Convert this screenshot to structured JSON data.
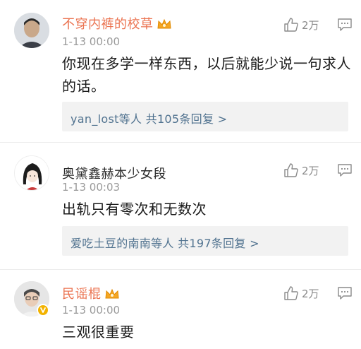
{
  "comments": [
    {
      "username": "不穿内裤的校草",
      "time": "1-13 00:00",
      "text": "你现在多学一样东西，以后就能少说一句求人的话。",
      "likes": "2万",
      "reply_summary": "yan_lost等人 共105条回复 >",
      "crown_icon": "vip-crown-icon"
    },
    {
      "username": "奥黛鑫赫本少女段",
      "time": "1-13 00:03",
      "text": "出轨只有零次和无数次",
      "likes": "2万",
      "reply_summary": "爱吃土豆的南南等人 共197条回复 >"
    },
    {
      "username": "民谣棍",
      "time": "1-13 00:00",
      "text": "三观很重要",
      "likes": "2万",
      "crown_icon": "vip-crown-icon",
      "verified_badge": "verified-v-icon"
    }
  ],
  "colors": {
    "vip_name": "#eb7350",
    "reply_link": "#50728f",
    "reply_bg": "#f2f2f2",
    "time": "#9a9a9a",
    "badge": "#f3b300"
  }
}
